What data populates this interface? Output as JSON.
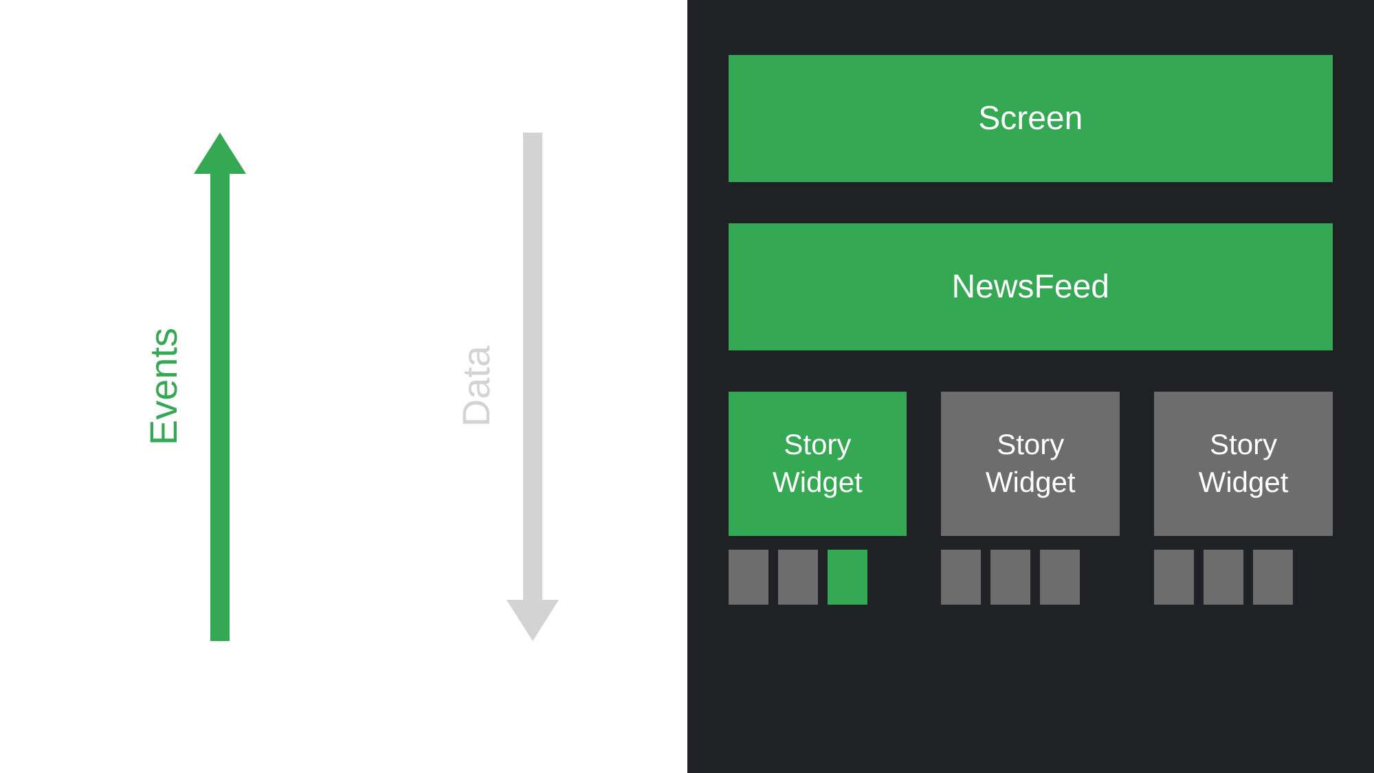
{
  "left": {
    "events_label": "Events",
    "data_label": "Data"
  },
  "right": {
    "screen_label": "Screen",
    "newsfeed_label": "NewsFeed",
    "widgets": [
      {
        "label": "Story\nWidget",
        "active": true,
        "small_blocks": [
          {
            "active": false
          },
          {
            "active": false
          },
          {
            "active": true
          }
        ]
      },
      {
        "label": "Story\nWidget",
        "active": false,
        "small_blocks": [
          {
            "active": false
          },
          {
            "active": false
          },
          {
            "active": false
          }
        ]
      },
      {
        "label": "Story\nWidget",
        "active": false,
        "small_blocks": [
          {
            "active": false
          },
          {
            "active": false
          },
          {
            "active": false
          }
        ]
      }
    ]
  },
  "colors": {
    "green": "#34a853",
    "grey": "#6d6d6d",
    "light_grey": "#d3d3d3",
    "dark_bg": "#1f2124"
  }
}
